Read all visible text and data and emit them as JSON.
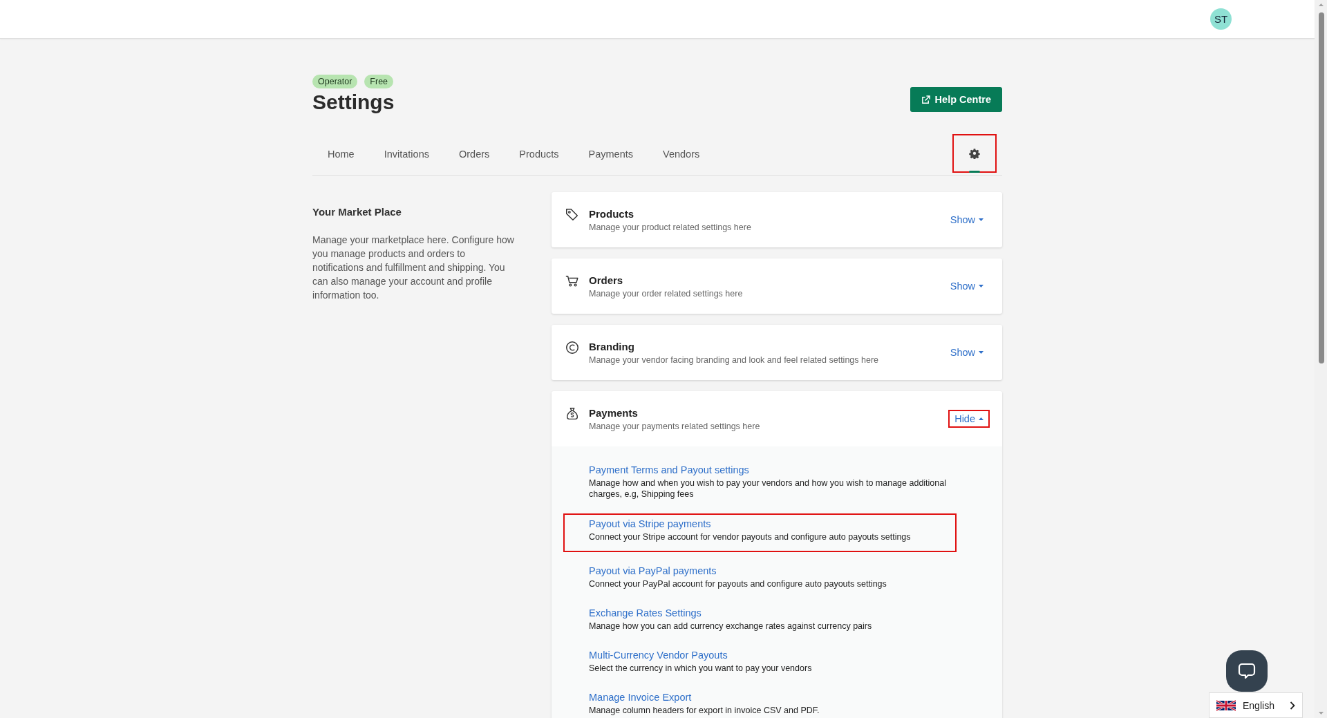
{
  "header": {
    "avatar": "ST"
  },
  "badges": [
    "Operator",
    "Free"
  ],
  "title": "Settings",
  "help_button": "Help Centre",
  "tabs": [
    {
      "kind": "text",
      "label": "Home",
      "selected": false,
      "annotated": false
    },
    {
      "kind": "text",
      "label": "Invitations",
      "selected": false,
      "annotated": false
    },
    {
      "kind": "text",
      "label": "Orders",
      "selected": false,
      "annotated": false
    },
    {
      "kind": "text",
      "label": "Products",
      "selected": false,
      "annotated": false
    },
    {
      "kind": "text",
      "label": "Payments",
      "selected": false,
      "annotated": false
    },
    {
      "kind": "text",
      "label": "Vendors",
      "selected": false,
      "annotated": false
    },
    {
      "kind": "settings",
      "selected": true,
      "annotated": true
    }
  ],
  "intro": {
    "heading": "Your Market Place",
    "text": "Manage your marketplace here. Configure how you manage products and orders to notifications and fulfillment and shipping. You can also manage your account and profile information too."
  },
  "sections": [
    {
      "kind": "tag",
      "title": "Products",
      "description": "Manage your product related settings here",
      "toggle": "Show",
      "expanded": false,
      "toggle_annotated": false
    },
    {
      "kind": "cart",
      "title": "Orders",
      "description": "Manage your order related settings here",
      "toggle": "Show",
      "expanded": false,
      "toggle_annotated": false
    },
    {
      "kind": "copyright",
      "title": "Branding",
      "description": "Manage your vendor facing branding and look and feel related settings here",
      "toggle": "Show",
      "expanded": false,
      "toggle_annotated": false
    },
    {
      "kind": "moneybag",
      "title": "Payments",
      "description": "Manage your payments related settings here",
      "toggle": "Hide",
      "expanded": true,
      "toggle_annotated": true,
      "items": [
        {
          "title": "Payment Terms and Payout settings",
          "description": "Manage how and when you wish to pay your vendors and how you wish to manage additional charges, e.g, Shipping fees",
          "annotated": false
        },
        {
          "title": "Payout via Stripe payments",
          "description": "Connect your Stripe account for vendor payouts and configure auto payouts settings",
          "annotated": true
        },
        {
          "title": "Payout via PayPal payments",
          "description": "Connect your PayPal account for payouts and configure auto payouts settings",
          "annotated": false
        },
        {
          "title": "Exchange Rates Settings",
          "description": "Manage how you can add currency exchange rates against currency pairs",
          "annotated": false
        },
        {
          "title": "Multi-Currency Vendor Payouts",
          "description": "Select the currency in which you want to pay your vendors",
          "annotated": false
        },
        {
          "title": "Manage Invoice Export",
          "description": "Manage column headers for export in invoice CSV and PDF.",
          "annotated": false
        }
      ]
    }
  ],
  "language": {
    "label": "English"
  }
}
